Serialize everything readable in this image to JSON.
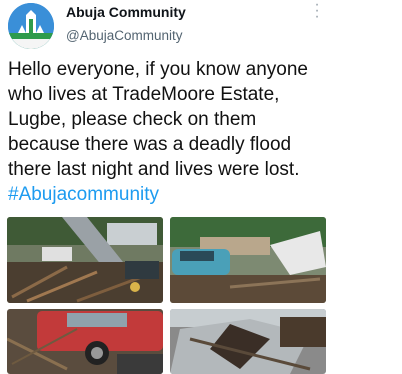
{
  "author": {
    "display_name": "Abuja Community",
    "handle": "@AbujaCommunity",
    "avatar_icon": "abuja-monument-icon"
  },
  "more_icon": "more-options-icon",
  "tweet": {
    "text_lines": [
      "Hello everyone, if you know anyone",
      "who lives at TradeMoore Estate,",
      "Lugbe, please check on them",
      "because there was a deadly flood",
      "there last night and lives were lost."
    ],
    "hashtag": "#Abujacommunity"
  },
  "colors": {
    "hashtag": "#1d9bf0",
    "handle": "#536471",
    "avatar_bg": "#3a8fd8"
  },
  "photos": [
    {
      "name": "flood-photo-debris-wreckage"
    },
    {
      "name": "flood-photo-blue-car-flooded"
    },
    {
      "name": "flood-photo-red-car-debris"
    },
    {
      "name": "flood-photo-damaged-silver-car"
    }
  ]
}
